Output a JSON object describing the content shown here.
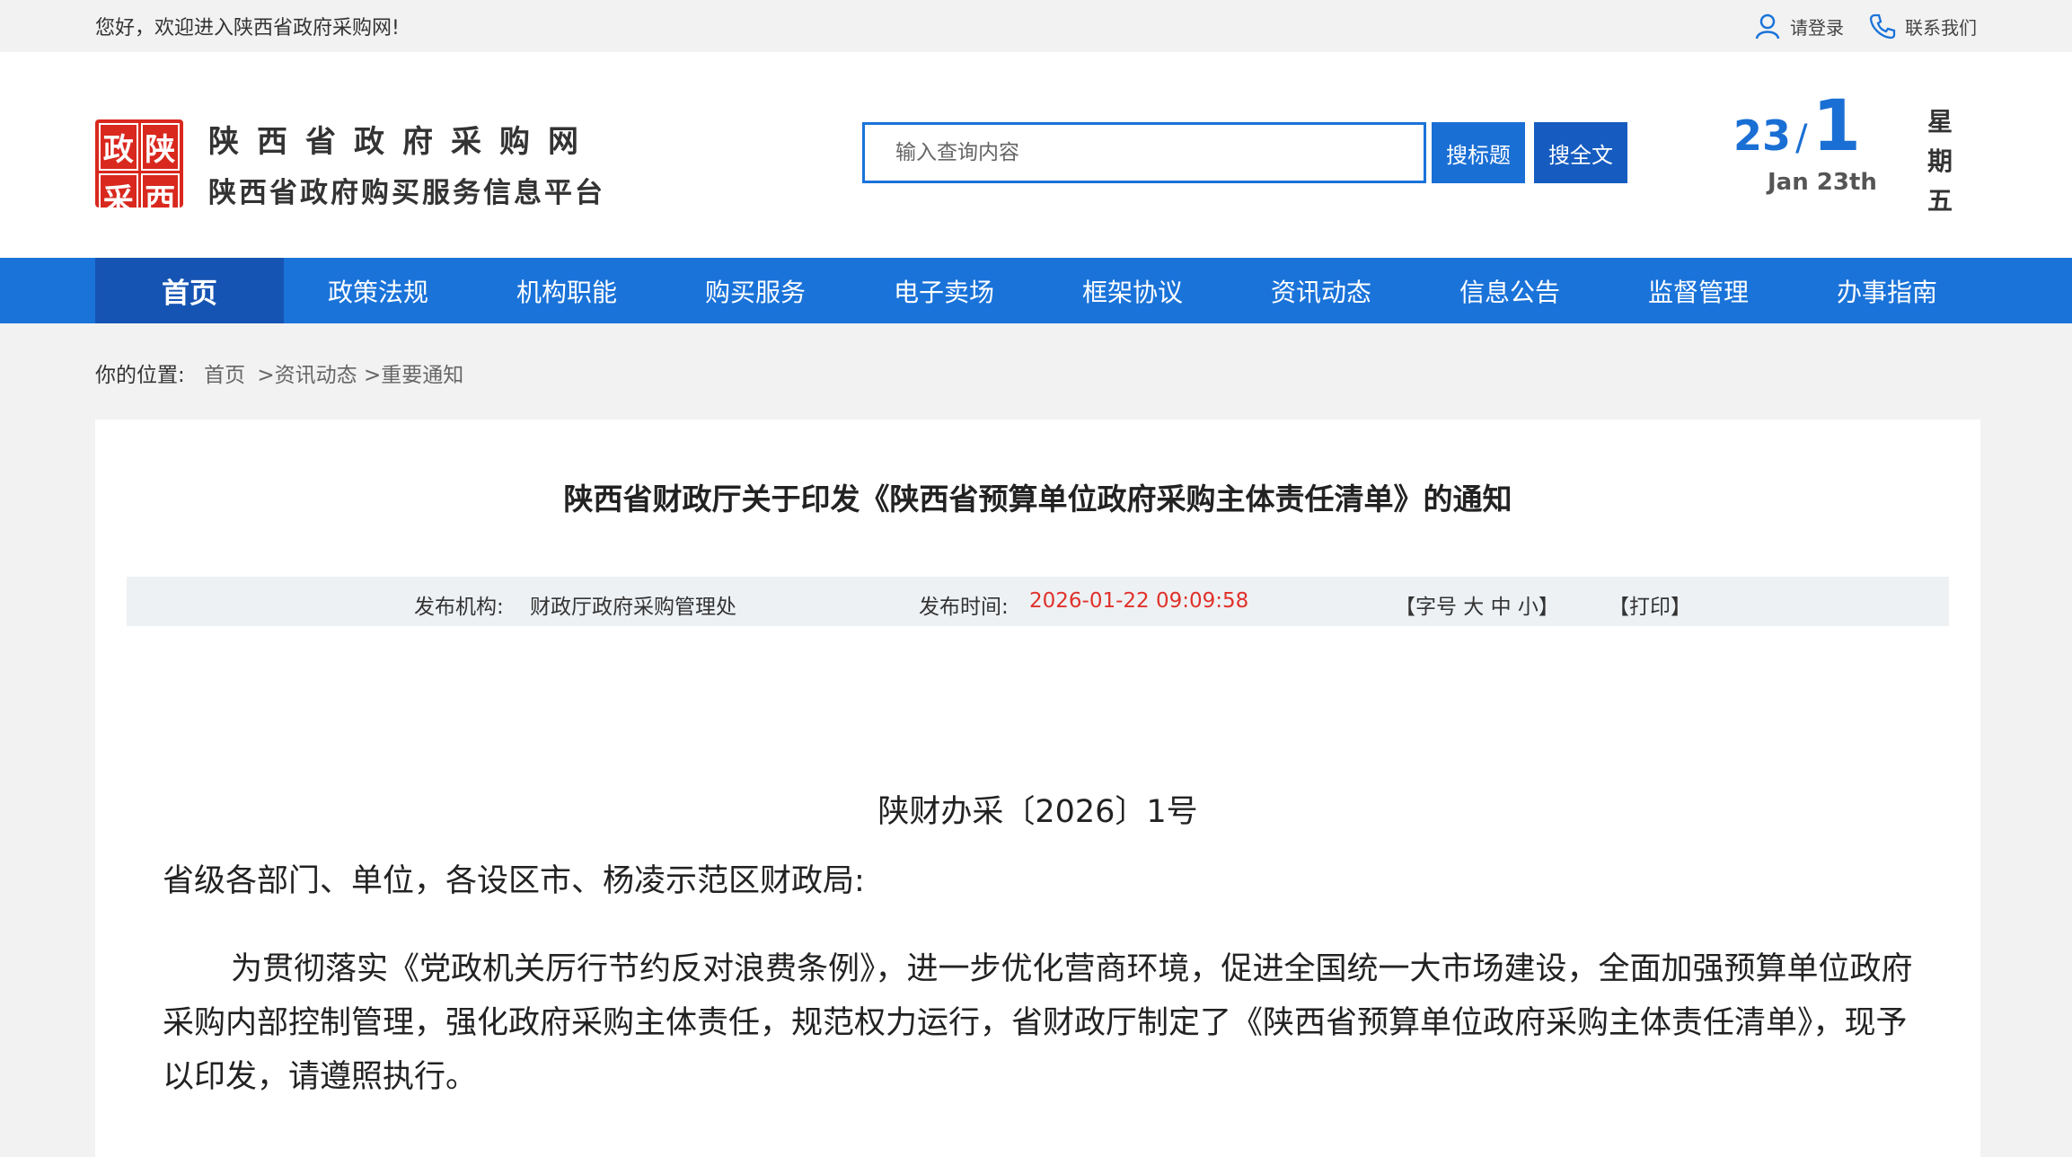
{
  "topbar": {
    "welcome": "您好，欢迎进入陕西省政府采购网!",
    "login": "请登录",
    "contact": "联系我们"
  },
  "logo": {
    "chars": [
      "政",
      "陕",
      "采",
      "西"
    ],
    "title": "陕西省政府采购网",
    "subtitle": "陕西省政府购买服务信息平台"
  },
  "search": {
    "placeholder": "输入查询内容",
    "btn_title": "搜标题",
    "btn_fulltext": "搜全文"
  },
  "date": {
    "day": "23",
    "slash": "/",
    "month": "1",
    "en": "Jan 23th",
    "weekday": [
      "星",
      "期",
      "五"
    ]
  },
  "nav": [
    "首页",
    "政策法规",
    "机构职能",
    "购买服务",
    "电子卖场",
    "框架协议",
    "资讯动态",
    "信息公告",
    "监督管理",
    "办事指南"
  ],
  "breadcrumb": {
    "label": "你的位置:",
    "items": [
      "首页",
      ">资讯动态",
      ">重要通知"
    ]
  },
  "article": {
    "title": "陕西省财政厅关于印发《陕西省预算单位政府采购主体责任清单》的通知",
    "publisher_label": "发布机构:",
    "publisher": "财政厅政府采购管理处",
    "time_label": "发布时间:",
    "time": "2026-01-22 09:09:58",
    "font_size_ctrl": "【字号 大 中 小】",
    "print": "【打印】",
    "doc_number": "陕财办采〔2026〕1号",
    "salutation": "省级各部门、单位，各设区市、杨凌示范区财政局:",
    "body": "为贯彻落实《党政机关厉行节约反对浪费条例》，进一步优化营商环境，促进全国统一大市场建设，全面加强预算单位政府采购内部控制管理，强化政府采购主体责任，规范权力运行，省财政厅制定了《陕西省预算单位政府采购主体责任清单》，现予以印发，请遵照执行。"
  },
  "colors": {
    "nav_bg": "#1a73d9",
    "nav_active": "#1654b3",
    "logo_red": "#d9281e",
    "time_red": "#e0312a"
  }
}
